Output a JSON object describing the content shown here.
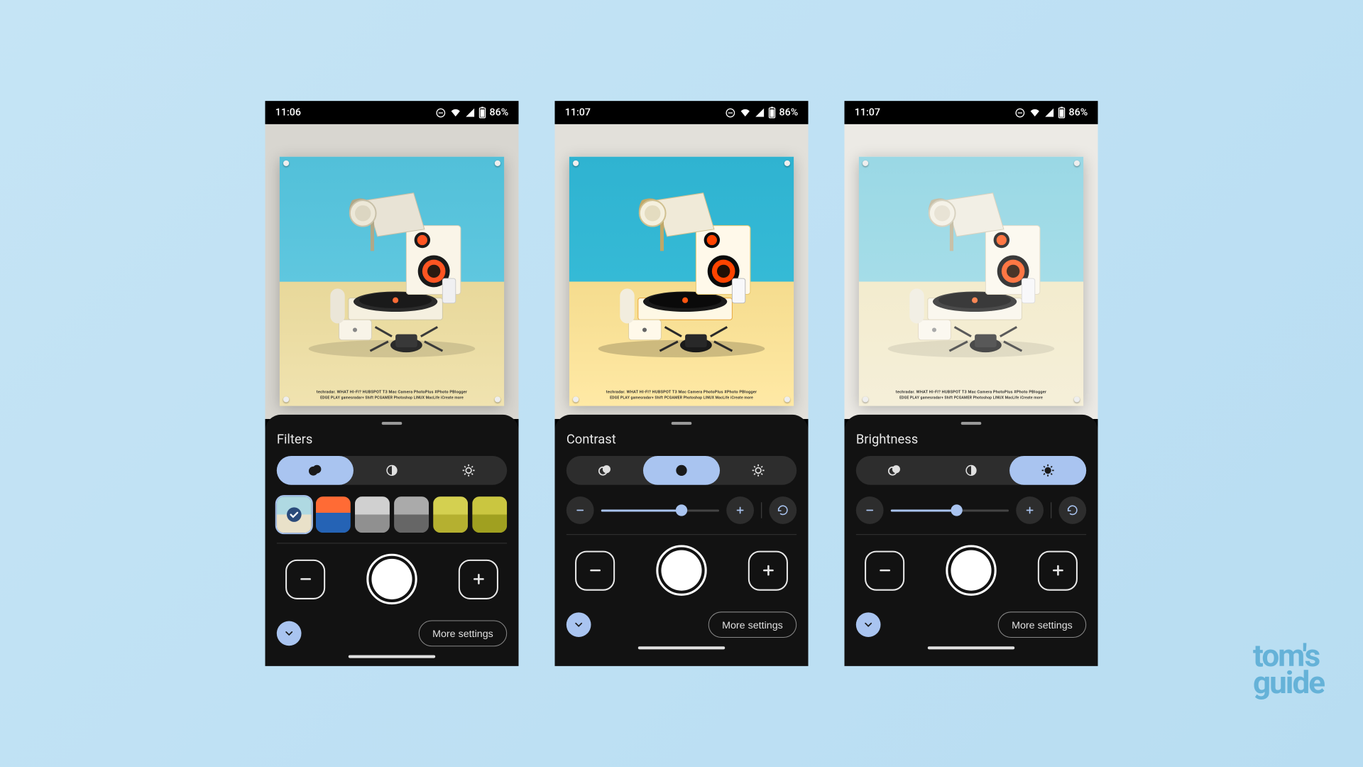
{
  "screens": [
    {
      "time": "11:06",
      "battery": "86%",
      "title": "Filters",
      "active_tab": 0,
      "type": "filters"
    },
    {
      "time": "11:07",
      "battery": "86%",
      "title": "Contrast",
      "active_tab": 1,
      "type": "slider",
      "slider_pct": 68
    },
    {
      "time": "11:07",
      "battery": "86%",
      "title": "Brightness",
      "active_tab": 2,
      "type": "slider",
      "slider_pct": 56
    }
  ],
  "tabs": {
    "filters_icon": "filters-icon",
    "contrast_icon": "contrast-icon",
    "brightness_icon": "brightness-icon"
  },
  "filter_thumbs": [
    {
      "id": "original",
      "selected": true
    },
    {
      "id": "cool",
      "selected": false
    },
    {
      "id": "bw1",
      "selected": false
    },
    {
      "id": "bw2",
      "selected": false
    },
    {
      "id": "yellow1",
      "selected": false
    },
    {
      "id": "yellow2",
      "selected": false
    }
  ],
  "more_settings_label": "More settings",
  "poster": {
    "line1": "techradar. WHAT HI-FI? HUBSPOT T3 Mac Camera PhotoPlus #Photo PBlogger",
    "line2": "EDGE PLAY gamesradar+ Shift PCGAMER Photoshop LINUX MacLife iCreate more"
  },
  "watermark": {
    "line1": "tom's",
    "line2": "guide"
  }
}
